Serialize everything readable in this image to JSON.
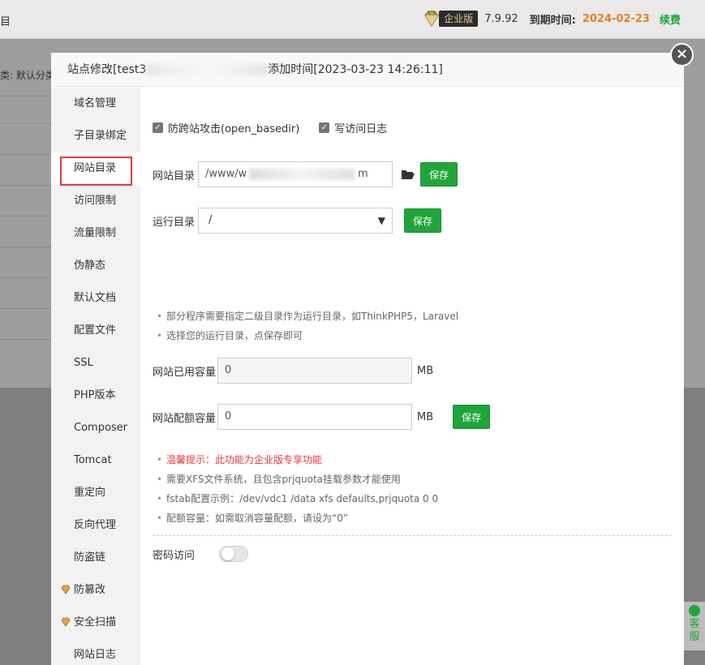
{
  "header": {
    "left_fragment": "目",
    "edition_label": "企业版",
    "version": "7.9.92",
    "expire_label": "到期时间:",
    "expire_date": "2024-02-23",
    "renew_label": "续费"
  },
  "background": {
    "category_fragment": "类: 默认分类"
  },
  "modal": {
    "title_prefix": "站点修改[test3",
    "title_suffix": "添加时间[2023-03-23 14:26:11]",
    "close_glyph": "×"
  },
  "sidebar": {
    "items": [
      {
        "label": "域名管理",
        "premium": false
      },
      {
        "label": "子目录绑定",
        "premium": false
      },
      {
        "label": "网站目录",
        "premium": false,
        "active": true
      },
      {
        "label": "访问限制",
        "premium": false
      },
      {
        "label": "流量限制",
        "premium": false
      },
      {
        "label": "伪静态",
        "premium": false
      },
      {
        "label": "默认文档",
        "premium": false
      },
      {
        "label": "配置文件",
        "premium": false
      },
      {
        "label": "SSL",
        "premium": false
      },
      {
        "label": "PHP版本",
        "premium": false
      },
      {
        "label": "Composer",
        "premium": false
      },
      {
        "label": "Tomcat",
        "premium": false
      },
      {
        "label": "重定向",
        "premium": false
      },
      {
        "label": "反向代理",
        "premium": false
      },
      {
        "label": "防盗链",
        "premium": false
      },
      {
        "label": "防篡改",
        "premium": true
      },
      {
        "label": "安全扫描",
        "premium": true
      },
      {
        "label": "网站日志",
        "premium": false
      }
    ]
  },
  "options": {
    "open_basedir_label": "防跨站攻击(open_basedir)",
    "open_basedir_checked": true,
    "access_log_label": "写访问日志",
    "access_log_checked": true
  },
  "site_dir": {
    "label": "网站目录",
    "value_prefix": "/www/w",
    "value_suffix": "m",
    "save_label": "保存"
  },
  "run_dir": {
    "label": "运行目录",
    "selected": "/",
    "save_label": "保存"
  },
  "run_tips": [
    "部分程序需要指定二级目录作为运行目录，如ThinkPHP5，Laravel",
    "选择您的运行目录，点保存即可"
  ],
  "used_quota": {
    "label": "网站已用容量",
    "value": "0",
    "unit": "MB"
  },
  "quota": {
    "label": "网站配额容量",
    "value": "0",
    "unit": "MB",
    "save_label": "保存"
  },
  "quota_tips": {
    "warning": "温馨提示：此功能为企业版专享功能",
    "items": [
      "需要XFS文件系统，且包含prjquota挂载参数才能使用",
      "fstab配置示例：/dev/vdc1 /data xfs defaults,prjquota 0 0",
      "配额容量：如需取消容量配额，请设为“0”"
    ]
  },
  "password_access": {
    "label": "密码访问",
    "enabled": false
  },
  "service": {
    "label": "客服"
  },
  "colors": {
    "accent_green": "#20a53a",
    "active_border": "#e53935",
    "expire_orange": "#e67e22"
  }
}
